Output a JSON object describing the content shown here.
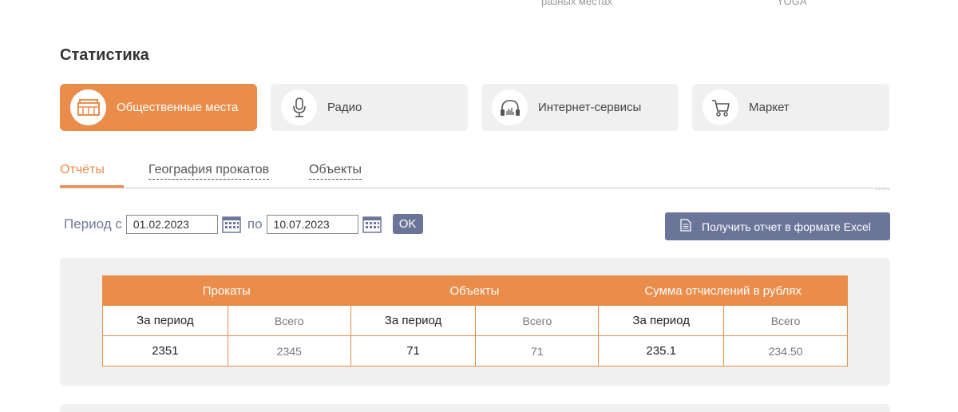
{
  "top_fragments": [
    "разных местах",
    "YOGA"
  ],
  "section_title": "Статистика",
  "categories": [
    {
      "label": "Общественные места",
      "icon": "public-places-icon",
      "active": true
    },
    {
      "label": "Радио",
      "icon": "microphone-icon",
      "active": false
    },
    {
      "label": "Интернет-сервисы",
      "icon": "headphones-icon",
      "active": false
    },
    {
      "label": "Маркет",
      "icon": "cart-icon",
      "active": false
    }
  ],
  "tabs": [
    {
      "label": "Отчёты",
      "active": true
    },
    {
      "label": "География прокатов",
      "active": false
    },
    {
      "label": "Объекты",
      "active": false
    }
  ],
  "period": {
    "from_label": "Период с",
    "from_value": "01.02.2023",
    "to_label": "по",
    "to_value": "10.07.2023",
    "ok_label": "OK"
  },
  "excel_button": {
    "label": "Получить отчет в формате Excel",
    "icon": "document-icon"
  },
  "stats_table": {
    "groups": [
      "Прокаты",
      "Объекты",
      "Сумма отчислений в рублях"
    ],
    "subheaders": [
      "За период",
      "Всего",
      "За период",
      "Всего",
      "За период",
      "Всего"
    ],
    "values": [
      "2351",
      "2345",
      "71",
      "71",
      "235.1",
      "234.50"
    ]
  },
  "colors": {
    "accent": "#ea8c4a",
    "button": "#6b7599",
    "panel": "#f0f0f0",
    "period_text": "#6e7a99"
  }
}
